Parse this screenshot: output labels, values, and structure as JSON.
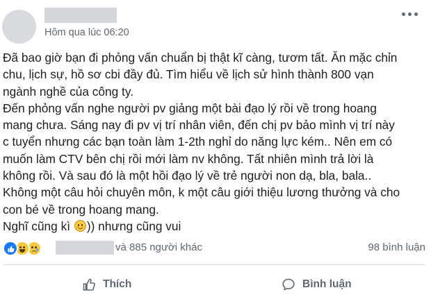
{
  "post": {
    "author_name": "",
    "timestamp": "Hôm qua lúc 06:20",
    "body_lines": [
      "Đã bao giờ bạn đi phỏng vấn chuẩn bị thật kĩ càng, tươm tất. Ăn mặc chỉn",
      "chu, lịch sự, hồ sơ cbi đầy đủ. Tìm hiểu về lịch sử hình thành 800 vạn",
      "ngành nghề của công ty.",
      "Đến phỏng vấn nghe người pv giảng một bài đạo lý rồi về trong hoang",
      "mang chưa. Sáng nay đi pv vị trí nhân viên, đến chị pv bảo mình vị trí này",
      "c tuyển nhưng các bạn toàn làm 1-2th nghỉ do năng lực kém.. Nên em có",
      "muốn làm CTV bên chị rồi mới làm nv không. Tất nhiên mình trả lời là",
      "không rồi. Và sau đó là một hồi đạo lý về trẻ người non dạ, bla, bala..",
      "Không một câu hỏi chuyên môn, k một câu giới thiệu lương thưởng và cho",
      "con bé về trong hoang mang."
    ],
    "last_line_before_emoji": "Nghĩ cũng kì ",
    "last_line_after_emoji": ")) nhưng cũng vui"
  },
  "reactions": {
    "icons": [
      "like-icon",
      "haha-icon",
      "sad-icon"
    ],
    "others_text": "và 885 người khác",
    "comments_text": "98 bình luận"
  },
  "actions": {
    "like_label": "Thích",
    "comment_label": "Bình luận"
  },
  "colors": {
    "like_blue": "#1877f2",
    "secondary_text": "#616770",
    "action_text": "#606770"
  }
}
